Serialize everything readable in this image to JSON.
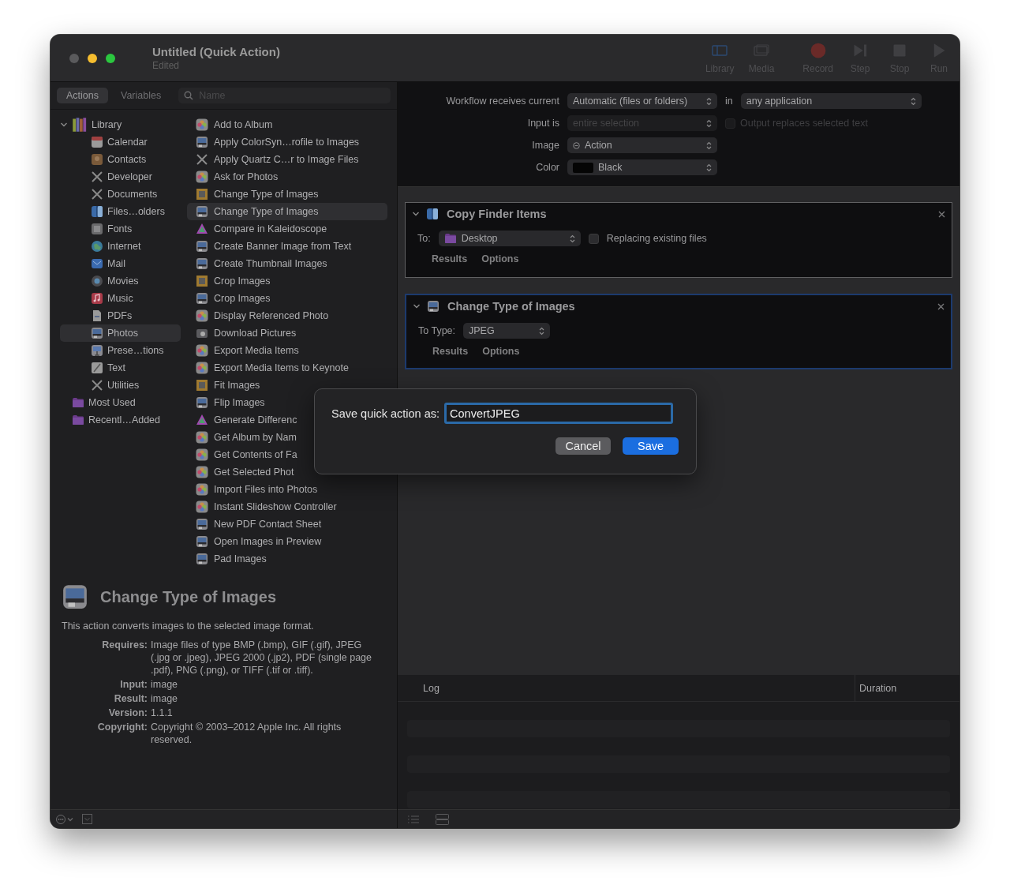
{
  "window": {
    "title": "Untitled (Quick Action)",
    "subtitle": "Edited"
  },
  "toolbar": [
    {
      "label": "Library",
      "kind": "library"
    },
    {
      "label": "Media",
      "kind": "media"
    },
    {
      "label": "Record",
      "kind": "record"
    },
    {
      "label": "Step",
      "kind": "step"
    },
    {
      "label": "Stop",
      "kind": "stop"
    },
    {
      "label": "Run",
      "kind": "run"
    }
  ],
  "library_tabs": [
    {
      "label": "Actions",
      "selected": true
    },
    {
      "label": "Variables",
      "selected": false
    }
  ],
  "search": {
    "placeholder": "Name"
  },
  "library": [
    {
      "label": "Library",
      "kind": "books",
      "expanded": true,
      "selected": false,
      "children": [
        {
          "label": "Calendar",
          "kind": "calendar",
          "selected": false
        },
        {
          "label": "Contacts",
          "kind": "contacts",
          "selected": false
        },
        {
          "label": "Developer",
          "kind": "tools",
          "selected": false
        },
        {
          "label": "Documents",
          "kind": "tools",
          "selected": false
        },
        {
          "label": "Files…olders",
          "kind": "finder",
          "selected": false
        },
        {
          "label": "Fonts",
          "kind": "fonts",
          "selected": false
        },
        {
          "label": "Internet",
          "kind": "globe",
          "selected": false
        },
        {
          "label": "Mail",
          "kind": "mail",
          "selected": false
        },
        {
          "label": "Movies",
          "kind": "movies",
          "selected": false
        },
        {
          "label": "Music",
          "kind": "music",
          "selected": false
        },
        {
          "label": "PDFs",
          "kind": "pdf",
          "selected": false
        },
        {
          "label": "Photos",
          "kind": "image",
          "selected": true
        },
        {
          "label": "Prese…tions",
          "kind": "keynote",
          "selected": false
        },
        {
          "label": "Text",
          "kind": "text",
          "selected": false
        },
        {
          "label": "Utilities",
          "kind": "tools",
          "selected": false
        }
      ]
    },
    {
      "label": "Most Used",
      "kind": "folder",
      "selected": false
    },
    {
      "label": "Recentl…Added",
      "kind": "folder",
      "selected": false
    }
  ],
  "actions": [
    {
      "label": "Add to Album",
      "kind": "flower",
      "selected": false
    },
    {
      "label": "Apply ColorSyn…rofile to Images",
      "kind": "image",
      "selected": false
    },
    {
      "label": "Apply Quartz C…r to Image Files",
      "kind": "tools",
      "selected": false
    },
    {
      "label": "Ask for Photos",
      "kind": "flower",
      "selected": false
    },
    {
      "label": "Change Type of Images",
      "kind": "frame",
      "selected": false
    },
    {
      "label": "Change Type of Images",
      "kind": "image",
      "selected": true
    },
    {
      "label": "Compare in Kaleidoscope",
      "kind": "prism",
      "selected": false
    },
    {
      "label": "Create Banner Image from Text",
      "kind": "image",
      "selected": false
    },
    {
      "label": "Create Thumbnail Images",
      "kind": "image",
      "selected": false
    },
    {
      "label": "Crop Images",
      "kind": "frame",
      "selected": false
    },
    {
      "label": "Crop Images",
      "kind": "image",
      "selected": false
    },
    {
      "label": "Display Referenced Photo",
      "kind": "flower",
      "selected": false
    },
    {
      "label": "Download Pictures",
      "kind": "camera",
      "selected": false
    },
    {
      "label": "Export Media Items",
      "kind": "flower",
      "selected": false
    },
    {
      "label": "Export Media Items to Keynote",
      "kind": "flower",
      "selected": false
    },
    {
      "label": "Fit Images",
      "kind": "frame",
      "selected": false
    },
    {
      "label": "Flip Images",
      "kind": "image",
      "selected": false
    },
    {
      "label": "Generate Differenc",
      "kind": "prism",
      "selected": false
    },
    {
      "label": "Get Album by Nam",
      "kind": "flower",
      "selected": false
    },
    {
      "label": "Get Contents of Fa",
      "kind": "flower",
      "selected": false
    },
    {
      "label": "Get Selected Phot",
      "kind": "flower",
      "selected": false
    },
    {
      "label": "Import Files into Photos",
      "kind": "flower",
      "selected": false
    },
    {
      "label": "Instant Slideshow Controller",
      "kind": "flower",
      "selected": false
    },
    {
      "label": "New PDF Contact Sheet",
      "kind": "image",
      "selected": false
    },
    {
      "label": "Open Images in Preview",
      "kind": "image",
      "selected": false
    },
    {
      "label": "Pad Images",
      "kind": "image",
      "selected": false
    }
  ],
  "description": {
    "title": "Change Type of Images",
    "summary": "This action converts images to the selected image format.",
    "details": [
      {
        "label": "Requires:",
        "value": "Image files of type BMP (.bmp), GIF (.gif), JPEG (.jpg or .jpeg), JPEG 2000 (.jp2), PDF (single page .pdf), PNG (.png), or TIFF (.tif or .tiff)."
      },
      {
        "label": "Input:",
        "value": "image"
      },
      {
        "label": "Result:",
        "value": "image"
      },
      {
        "label": "Version:",
        "value": "1.1.1"
      },
      {
        "label": "Copyright:",
        "value": "Copyright © 2003–2012 Apple Inc.  All rights reserved."
      }
    ]
  },
  "settings": [
    {
      "kind": "receives",
      "label": "Workflow receives current",
      "value": "Automatic (files or folders)",
      "connector": "in",
      "target": "any application",
      "disabled": false
    },
    {
      "kind": "input",
      "label": "Input is",
      "value": "entire selection",
      "disabled": true,
      "option": {
        "label": "Output replaces selected text",
        "checked": false,
        "disabled": true
      }
    },
    {
      "kind": "image",
      "label": "Image",
      "value": "Action",
      "disabled": false
    },
    {
      "kind": "color",
      "label": "Color",
      "value": "Black",
      "disabled": false
    }
  ],
  "workflow": [
    {
      "title": "Copy Finder Items",
      "kind": "finder",
      "expanded": true,
      "selected": false,
      "fields": [
        {
          "kind": "location",
          "label": "To:",
          "value": "Desktop"
        },
        {
          "kind": "checkbox",
          "label": "Replacing existing files",
          "checked": false
        }
      ],
      "tabs": [
        "Results",
        "Options"
      ]
    },
    {
      "title": "Change Type of Images",
      "kind": "image",
      "expanded": true,
      "selected": true,
      "fields": [
        {
          "kind": "popup",
          "label": "To Type:",
          "value": "JPEG"
        }
      ],
      "tabs": [
        "Results",
        "Options"
      ]
    }
  ],
  "log": {
    "columns": [
      "Log",
      "Duration"
    ]
  },
  "dialog": {
    "label": "Save quick action as:",
    "value": "ConvertJPEG",
    "buttons": [
      {
        "label": "Cancel",
        "kind": "secondary"
      },
      {
        "label": "Save",
        "kind": "default"
      }
    ]
  }
}
